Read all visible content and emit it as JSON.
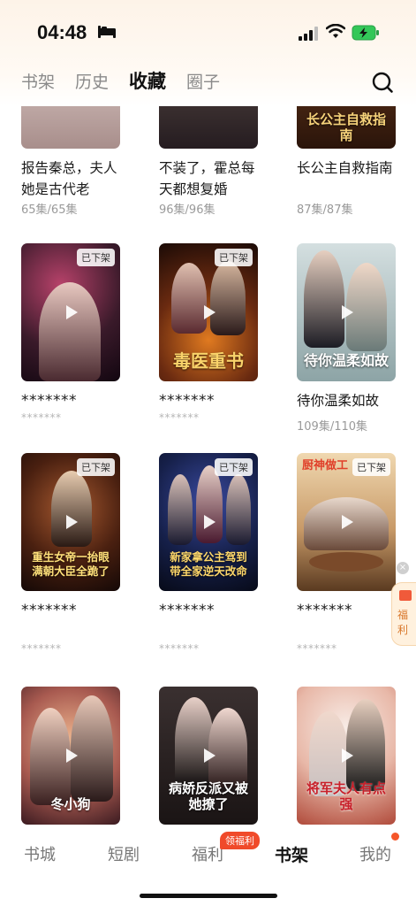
{
  "status_bar": {
    "time": "04:48"
  },
  "tabs": [
    {
      "label": "书架",
      "active": false
    },
    {
      "label": "历史",
      "active": false
    },
    {
      "label": "收藏",
      "active": true
    },
    {
      "label": "圈子",
      "active": false
    }
  ],
  "cards": [
    {
      "title": "报告秦总，夫人她是古代老",
      "count": "65集/65集",
      "badge": "",
      "cover_text": "",
      "colors": [
        "#e9d9d6",
        "#b8a2a0"
      ]
    },
    {
      "title": "不装了，霍总每天都想复婚",
      "count": "96集/96集",
      "badge": "",
      "cover_text": "",
      "colors": [
        "#5a4a44",
        "#2b2226"
      ]
    },
    {
      "title": "长公主自救指南",
      "count": "87集/87集",
      "badge": "",
      "cover_text": "长公主自救指南",
      "colors": [
        "#6b3b1e",
        "#2a140a"
      ]
    },
    {
      "title": "*******",
      "count": "*******",
      "badge": "已下架",
      "cover_text": "",
      "colors": [
        "#3a2230",
        "#14080e"
      ]
    },
    {
      "title": "*******",
      "count": "*******",
      "badge": "已下架",
      "cover_text": "毒医重书",
      "colors": [
        "#7a3a18",
        "#2a1508"
      ]
    },
    {
      "title": "待你温柔如故",
      "count": "109集/110集",
      "badge": "",
      "cover_text": "待你温柔如故",
      "colors": [
        "#c9d6d8",
        "#8fa6a8"
      ]
    },
    {
      "title": "*******",
      "count": "*******",
      "badge": "已下架",
      "cover_text": "重生女帝一抬眼 满朝大臣全跪了",
      "colors": [
        "#6b3420",
        "#1e0e08"
      ]
    },
    {
      "title": "*******",
      "count": "*******",
      "badge": "已下架",
      "cover_text": "新家拿公主驾到 带全家逆天改命",
      "colors": [
        "#23305c",
        "#0c1026"
      ]
    },
    {
      "title": "*******",
      "count": "*******",
      "badge": "已下架",
      "cover_text": "厨神做工",
      "colors": [
        "#d8b48a",
        "#7a5230"
      ]
    },
    {
      "title": "",
      "count": "",
      "badge": "",
      "cover_text": "冬小狗",
      "colors": [
        "#d99a7a",
        "#6a3a3a"
      ]
    },
    {
      "title": "",
      "count": "",
      "badge": "",
      "cover_text": "病娇反派又被她撩了",
      "colors": [
        "#4a3a3a",
        "#1a1212"
      ]
    },
    {
      "title": "",
      "count": "",
      "badge": "",
      "cover_text": "将军夫人有点强",
      "colors": [
        "#e9d5cf",
        "#b05040"
      ]
    }
  ],
  "float": {
    "close": "×",
    "label": "福利"
  },
  "bottom_nav": {
    "items": [
      {
        "label": "书城",
        "active": false
      },
      {
        "label": "短剧",
        "active": false
      },
      {
        "label": "福利",
        "active": false
      },
      {
        "label": "书架",
        "active": true
      },
      {
        "label": "我的",
        "active": false
      }
    ],
    "badge": "领福利"
  }
}
